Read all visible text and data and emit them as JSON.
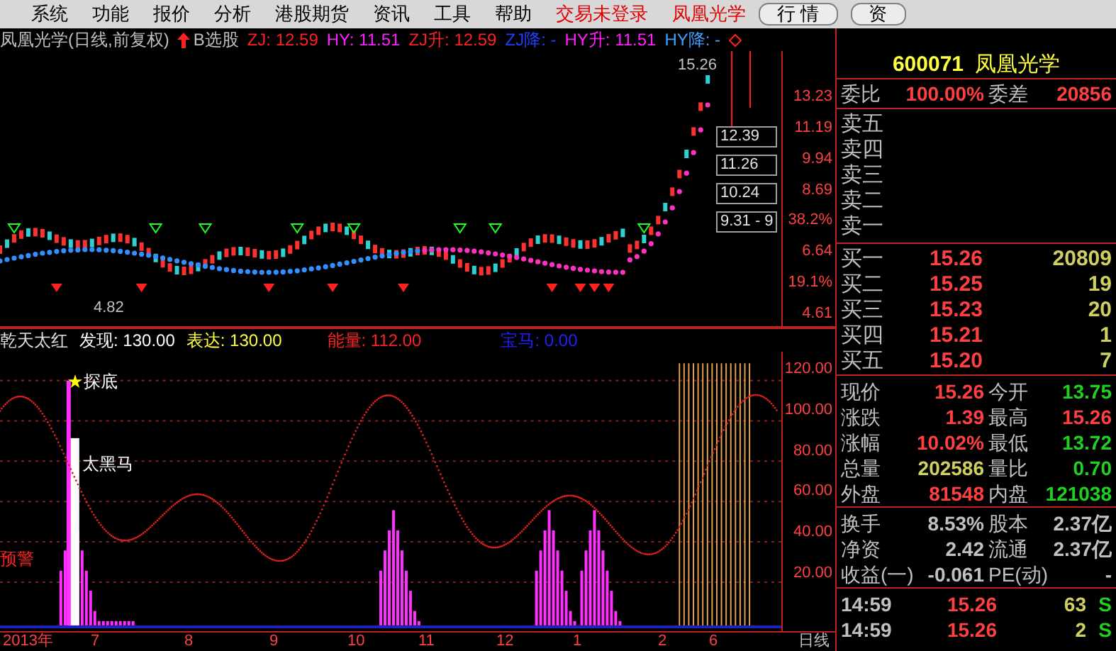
{
  "menu": [
    {
      "label": "系统",
      "kind": "item"
    },
    {
      "label": "功能",
      "kind": "item"
    },
    {
      "label": "报价",
      "kind": "item"
    },
    {
      "label": "分析",
      "kind": "item"
    },
    {
      "label": "港股期货",
      "kind": "item"
    },
    {
      "label": "资讯",
      "kind": "item"
    },
    {
      "label": "工具",
      "kind": "item"
    },
    {
      "label": "帮助",
      "kind": "item"
    },
    {
      "label": "交易未登录",
      "kind": "status"
    },
    {
      "label": "凤凰光学",
      "kind": "status"
    }
  ],
  "menu_buttons": [
    "行 情",
    "资"
  ],
  "chart": {
    "title": "凤凰光学(日线,前复权)",
    "signal": "B选股",
    "legend": [
      {
        "label": "ZJ: 12.59",
        "color": "#ff2020"
      },
      {
        "label": "HY: 11.51",
        "color": "#ff20ff"
      },
      {
        "label": "ZJ升: 12.59",
        "color": "#ff2020"
      },
      {
        "label": "ZJ降: -",
        "color": "#2040ff"
      },
      {
        "label": "HY升: 11.51",
        "color": "#ff20ff"
      },
      {
        "label": "HY降: -",
        "color": "#40a0ff"
      }
    ],
    "high_label": "15.26",
    "low_label": "4.82",
    "price_tags": [
      "12.39",
      "11.26",
      "10.24",
      "9.31 - 9"
    ],
    "price_axis": [
      "13.23",
      "11.19",
      "9.94",
      "8.69",
      "38.2%",
      "6.64",
      "19.1%",
      "4.61"
    ]
  },
  "indicator": {
    "name": "乾天太红",
    "values": [
      {
        "label": "发现: 130.00",
        "color": "#ffffff"
      },
      {
        "label": "表达: 130.00",
        "color": "#ffff40"
      },
      {
        "label": "能量: 112.00",
        "color": "#ff2020"
      },
      {
        "label": "宝马: 0.00",
        "color": "#2020ff"
      }
    ],
    "labels": [
      {
        "text": "探底",
        "kind": "star"
      },
      {
        "text": "太黑马",
        "kind": "plain"
      },
      {
        "text": "预警",
        "kind": "warn"
      }
    ],
    "axis": [
      "120.00",
      "100.00",
      "80.00",
      "60.00",
      "40.00",
      "20.00"
    ]
  },
  "date_axis": [
    "2013年",
    "7",
    "8",
    "9",
    "10",
    "11",
    "12",
    "1",
    "2",
    "6"
  ],
  "period": "日线",
  "quote": {
    "code": "600071",
    "name": "凤凰光学",
    "ratio": {
      "label": "委比",
      "value": "100.00%",
      "label2": "委差",
      "value2": "20856"
    },
    "sells": [
      {
        "label": "卖五"
      },
      {
        "label": "卖四"
      },
      {
        "label": "卖三"
      },
      {
        "label": "卖二"
      },
      {
        "label": "卖一"
      }
    ],
    "buys": [
      {
        "label": "买一",
        "price": "15.26",
        "volume": "20809"
      },
      {
        "label": "买二",
        "price": "15.25",
        "volume": "19"
      },
      {
        "label": "买三",
        "price": "15.23",
        "volume": "20"
      },
      {
        "label": "买四",
        "price": "15.21",
        "volume": "1"
      },
      {
        "label": "买五",
        "price": "15.20",
        "volume": "7"
      }
    ],
    "stats": [
      {
        "cells": [
          {
            "label": "现价",
            "value": "15.26",
            "color": "#ff4040"
          },
          {
            "label": "今开",
            "value": "13.75",
            "color": "#20d020"
          }
        ]
      },
      {
        "cells": [
          {
            "label": "涨跌",
            "value": "1.39",
            "color": "#ff4040"
          },
          {
            "label": "最高",
            "value": "15.26",
            "color": "#ff4040"
          }
        ]
      },
      {
        "cells": [
          {
            "label": "涨幅",
            "value": "10.02%",
            "color": "#ff4040"
          },
          {
            "label": "最低",
            "value": "13.72",
            "color": "#20d020"
          }
        ]
      },
      {
        "cells": [
          {
            "label": "总量",
            "value": "202586",
            "color": "#d0d060"
          },
          {
            "label": "量比",
            "value": "0.70",
            "color": "#20d020"
          }
        ]
      },
      {
        "cells": [
          {
            "label": "外盘",
            "value": "81548",
            "color": "#ff4040"
          },
          {
            "label": "内盘",
            "value": "121038",
            "color": "#20d020"
          }
        ]
      }
    ],
    "fundamentals": [
      {
        "label": "换手",
        "value": "8.53%",
        "label2": "股本",
        "value2": "2.37亿"
      },
      {
        "label": "净资",
        "value": "2.42",
        "label2": "流通",
        "value2": "2.37亿"
      },
      {
        "label": "收益(一)",
        "value": "-0.061",
        "label2": "PE(动)",
        "value2": "-"
      }
    ],
    "ticks": [
      {
        "time": "14:59",
        "price": "15.26",
        "volume": "63",
        "side": "S"
      },
      {
        "time": "14:59",
        "price": "15.26",
        "volume": "2",
        "side": "S"
      }
    ]
  }
}
